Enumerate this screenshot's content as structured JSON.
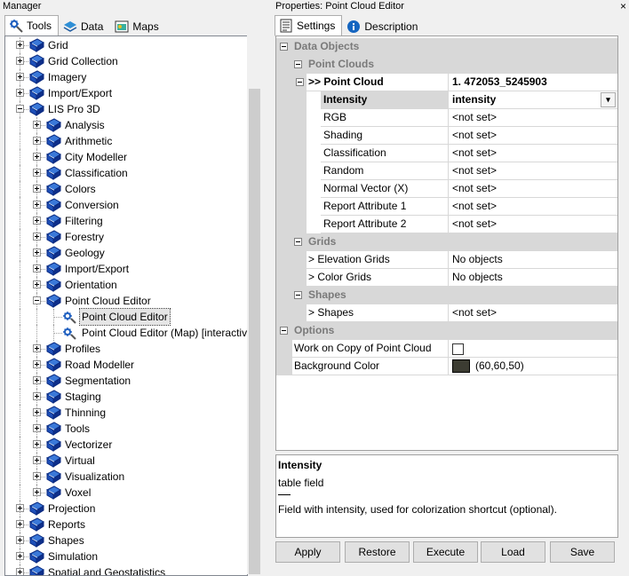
{
  "manager": {
    "title": "Manager",
    "tabs": [
      {
        "label": "Tools"
      },
      {
        "label": "Data"
      },
      {
        "label": "Maps"
      }
    ],
    "tree": [
      {
        "label": "Grid",
        "level": 0,
        "expander": "plus",
        "icon": "book"
      },
      {
        "label": "Grid Collection",
        "level": 0,
        "expander": "plus",
        "icon": "book"
      },
      {
        "label": "Imagery",
        "level": 0,
        "expander": "plus",
        "icon": "book"
      },
      {
        "label": "Import/Export",
        "level": 0,
        "expander": "plus",
        "icon": "book"
      },
      {
        "label": "LIS Pro 3D",
        "level": 0,
        "expander": "minus",
        "icon": "book"
      },
      {
        "label": "Analysis",
        "level": 1,
        "expander": "plus",
        "icon": "book"
      },
      {
        "label": "Arithmetic",
        "level": 1,
        "expander": "plus",
        "icon": "book"
      },
      {
        "label": "City Modeller",
        "level": 1,
        "expander": "plus",
        "icon": "book"
      },
      {
        "label": "Classification",
        "level": 1,
        "expander": "plus",
        "icon": "book"
      },
      {
        "label": "Colors",
        "level": 1,
        "expander": "plus",
        "icon": "book"
      },
      {
        "label": "Conversion",
        "level": 1,
        "expander": "plus",
        "icon": "book"
      },
      {
        "label": "Filtering",
        "level": 1,
        "expander": "plus",
        "icon": "book"
      },
      {
        "label": "Forestry",
        "level": 1,
        "expander": "plus",
        "icon": "book"
      },
      {
        "label": "Geology",
        "level": 1,
        "expander": "plus",
        "icon": "book"
      },
      {
        "label": "Import/Export",
        "level": 1,
        "expander": "plus",
        "icon": "book"
      },
      {
        "label": "Orientation",
        "level": 1,
        "expander": "plus",
        "icon": "book"
      },
      {
        "label": "Point Cloud Editor",
        "level": 1,
        "expander": "minus",
        "icon": "book"
      },
      {
        "label": "Point Cloud Editor",
        "level": 2,
        "expander": "none",
        "icon": "gear",
        "selected": true
      },
      {
        "label": "Point Cloud Editor (Map) [interactive]",
        "level": 2,
        "expander": "none",
        "icon": "gear"
      },
      {
        "label": "Profiles",
        "level": 1,
        "expander": "plus",
        "icon": "book"
      },
      {
        "label": "Road Modeller",
        "level": 1,
        "expander": "plus",
        "icon": "book"
      },
      {
        "label": "Segmentation",
        "level": 1,
        "expander": "plus",
        "icon": "book"
      },
      {
        "label": "Staging",
        "level": 1,
        "expander": "plus",
        "icon": "book"
      },
      {
        "label": "Thinning",
        "level": 1,
        "expander": "plus",
        "icon": "book"
      },
      {
        "label": "Tools",
        "level": 1,
        "expander": "plus",
        "icon": "book"
      },
      {
        "label": "Vectorizer",
        "level": 1,
        "expander": "plus",
        "icon": "book"
      },
      {
        "label": "Virtual",
        "level": 1,
        "expander": "plus",
        "icon": "book"
      },
      {
        "label": "Visualization",
        "level": 1,
        "expander": "plus",
        "icon": "book"
      },
      {
        "label": "Voxel",
        "level": 1,
        "expander": "plus",
        "icon": "book"
      },
      {
        "label": "Projection",
        "level": 0,
        "expander": "plus",
        "icon": "book"
      },
      {
        "label": "Reports",
        "level": 0,
        "expander": "plus",
        "icon": "book"
      },
      {
        "label": "Shapes",
        "level": 0,
        "expander": "plus",
        "icon": "book"
      },
      {
        "label": "Simulation",
        "level": 0,
        "expander": "plus",
        "icon": "book"
      },
      {
        "label": "Spatial and Geostatistics",
        "level": 0,
        "expander": "plus",
        "icon": "book"
      }
    ]
  },
  "properties": {
    "title": "Properties: Point Cloud Editor",
    "close": "×",
    "tabs": [
      {
        "label": "Settings"
      },
      {
        "label": "Description"
      }
    ],
    "rows": [
      {
        "kind": "cat",
        "level": 0,
        "name": "Data Objects"
      },
      {
        "kind": "cat",
        "level": 1,
        "name": "Point Clouds"
      },
      {
        "kind": "item",
        "level": 2,
        "name": ">> Point Cloud",
        "value": "1. 472053_5245903",
        "bold": true,
        "collapse": true
      },
      {
        "kind": "item",
        "level": 3,
        "name": "Intensity",
        "value": "intensity",
        "bold": true,
        "dropdown": true
      },
      {
        "kind": "item",
        "level": 3,
        "name": "RGB",
        "value": "<not set>"
      },
      {
        "kind": "item",
        "level": 3,
        "name": "Shading",
        "value": "<not set>"
      },
      {
        "kind": "item",
        "level": 3,
        "name": "Classification",
        "value": "<not set>"
      },
      {
        "kind": "item",
        "level": 3,
        "name": "Random",
        "value": "<not set>"
      },
      {
        "kind": "item",
        "level": 3,
        "name": "Normal Vector (X)",
        "value": "<not set>"
      },
      {
        "kind": "item",
        "level": 3,
        "name": "Report Attribute 1",
        "value": "<not set>"
      },
      {
        "kind": "item",
        "level": 3,
        "name": "Report Attribute 2",
        "value": "<not set>"
      },
      {
        "kind": "cat",
        "level": 1,
        "name": "Grids"
      },
      {
        "kind": "item",
        "level": 2,
        "name": "> Elevation Grids",
        "value": "No objects"
      },
      {
        "kind": "item",
        "level": 2,
        "name": "> Color Grids",
        "value": "No objects"
      },
      {
        "kind": "cat",
        "level": 1,
        "name": "Shapes"
      },
      {
        "kind": "item",
        "level": 2,
        "name": "> Shapes",
        "value": "<not set>"
      },
      {
        "kind": "cat",
        "level": 0,
        "name": "Options"
      },
      {
        "kind": "item",
        "level": 1,
        "name": "Work on Copy of Point Cloud",
        "value": "",
        "checkbox": true
      },
      {
        "kind": "item",
        "level": 1,
        "name": "Background Color",
        "value": "(60,60,50)",
        "color": "#3c3c32"
      }
    ],
    "description": {
      "title": "Intensity",
      "subtitle": "table field",
      "text": "Field with intensity, used for colorization shortcut (optional)."
    },
    "buttons": [
      {
        "label": "Apply"
      },
      {
        "label": "Restore"
      },
      {
        "label": "Execute"
      },
      {
        "label": "Load"
      },
      {
        "label": "Save"
      }
    ]
  }
}
